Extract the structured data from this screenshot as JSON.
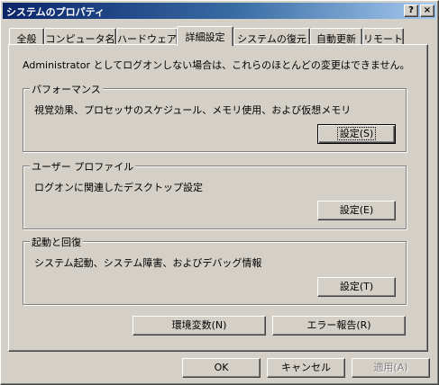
{
  "window": {
    "title": "システムのプロパティ",
    "help_button": "?",
    "close_button": "×"
  },
  "tabs": [
    {
      "label": "全般",
      "active": false
    },
    {
      "label": "コンピュータ名",
      "active": false
    },
    {
      "label": "ハードウェア",
      "active": false
    },
    {
      "label": "詳細設定",
      "active": true
    },
    {
      "label": "システムの復元",
      "active": false
    },
    {
      "label": "自動更新",
      "active": false
    },
    {
      "label": "リモート",
      "active": false
    }
  ],
  "advanced": {
    "notice": "Administrator としてログオンしない場合は、これらのほとんどの変更はできません。",
    "performance": {
      "title": "パフォーマンス",
      "description": "視覚効果、プロセッサのスケジュール、メモリ使用、および仮想メモリ",
      "button": "設定(S)"
    },
    "user_profiles": {
      "title": "ユーザー プロファイル",
      "description": "ログオンに関連したデスクトップ設定",
      "button": "設定(E)"
    },
    "startup_recovery": {
      "title": "起動と回復",
      "description": "システム起動、システム障害、およびデバッグ情報",
      "button": "設定(T)"
    },
    "env_vars_button": "環境変数(N)",
    "error_report_button": "エラー報告(R)"
  },
  "footer": {
    "ok": "OK",
    "cancel": "キャンセル",
    "apply": "適用(A)"
  }
}
